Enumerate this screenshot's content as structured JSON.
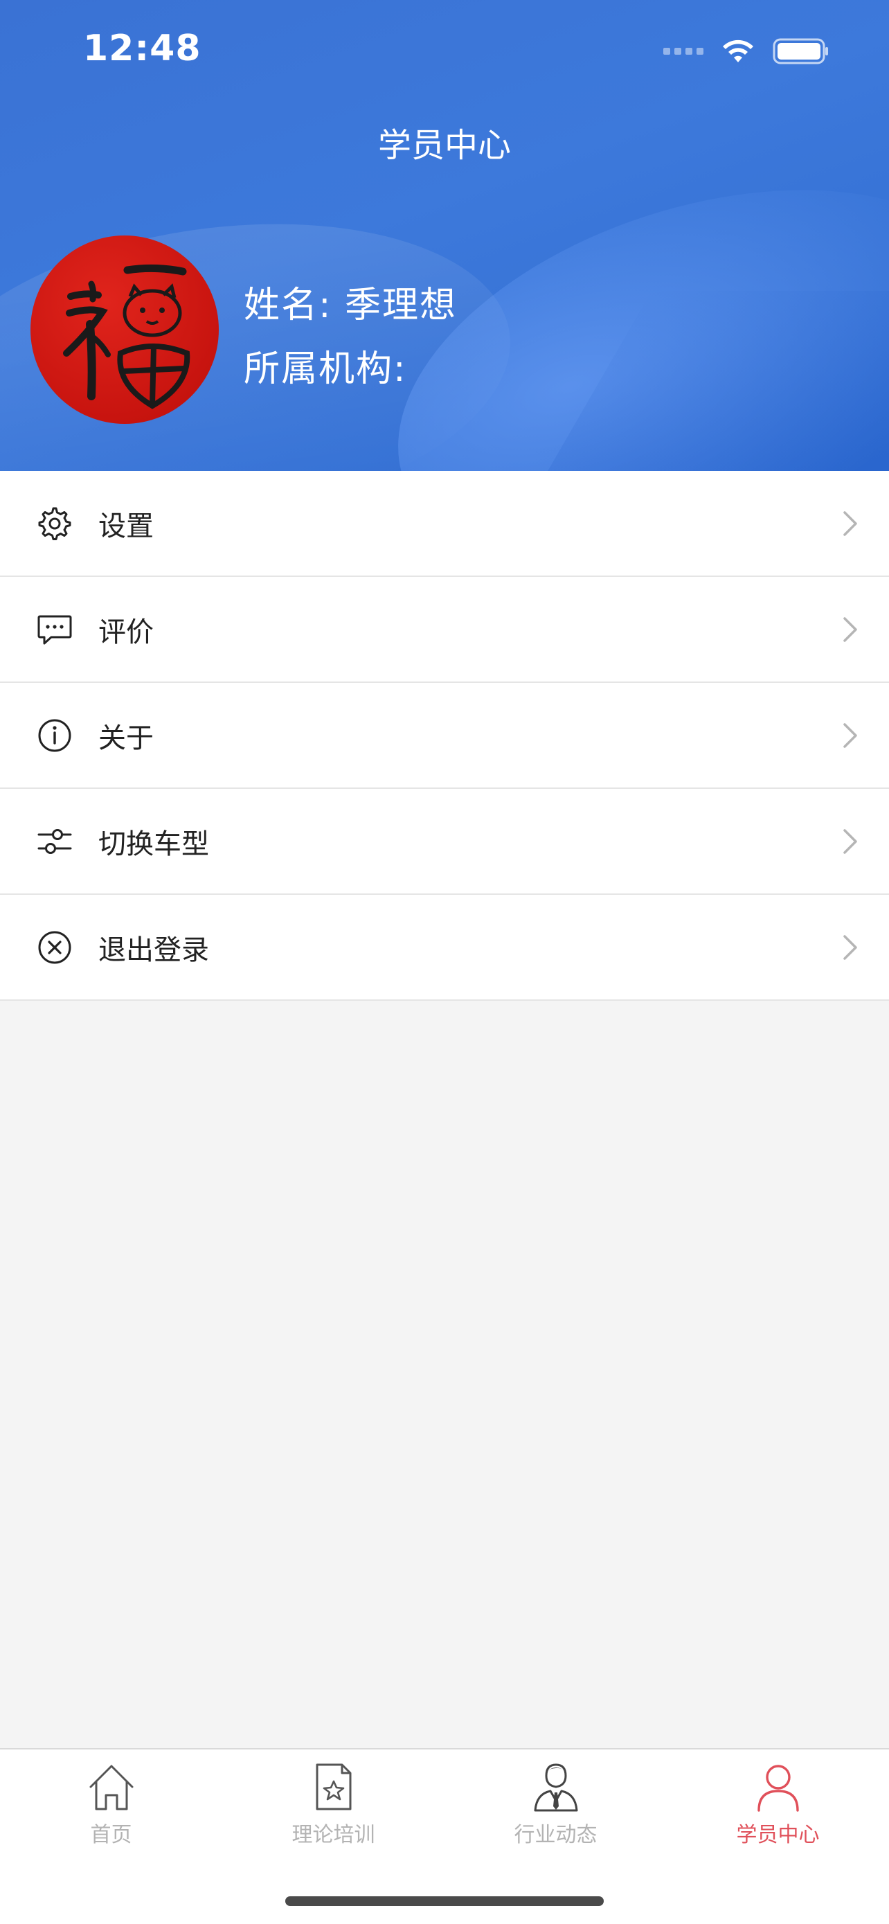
{
  "status_bar": {
    "time": "12:48"
  },
  "header": {
    "title": "学员中心",
    "name_label": "姓名:  季理想",
    "org_label": "所属机构:"
  },
  "menu": {
    "items": [
      {
        "label": "设置",
        "icon": "gear-icon"
      },
      {
        "label": "评价",
        "icon": "chat-bubble-icon"
      },
      {
        "label": "关于",
        "icon": "info-icon"
      },
      {
        "label": "切换车型",
        "icon": "sliders-icon"
      },
      {
        "label": "退出登录",
        "icon": "close-circle-icon"
      }
    ]
  },
  "tabbar": {
    "tabs": [
      {
        "label": "首页",
        "icon": "home-icon",
        "active": false
      },
      {
        "label": "理论培训",
        "icon": "document-star-icon",
        "active": false
      },
      {
        "label": "行业动态",
        "icon": "person-tie-icon",
        "active": false
      },
      {
        "label": "学员中心",
        "icon": "user-icon",
        "active": true
      }
    ]
  },
  "colors": {
    "header_blue": "#3a72d4",
    "active_tab": "#e0505a",
    "inactive_tab": "#b3b3b3",
    "background": "#f4f4f4"
  }
}
